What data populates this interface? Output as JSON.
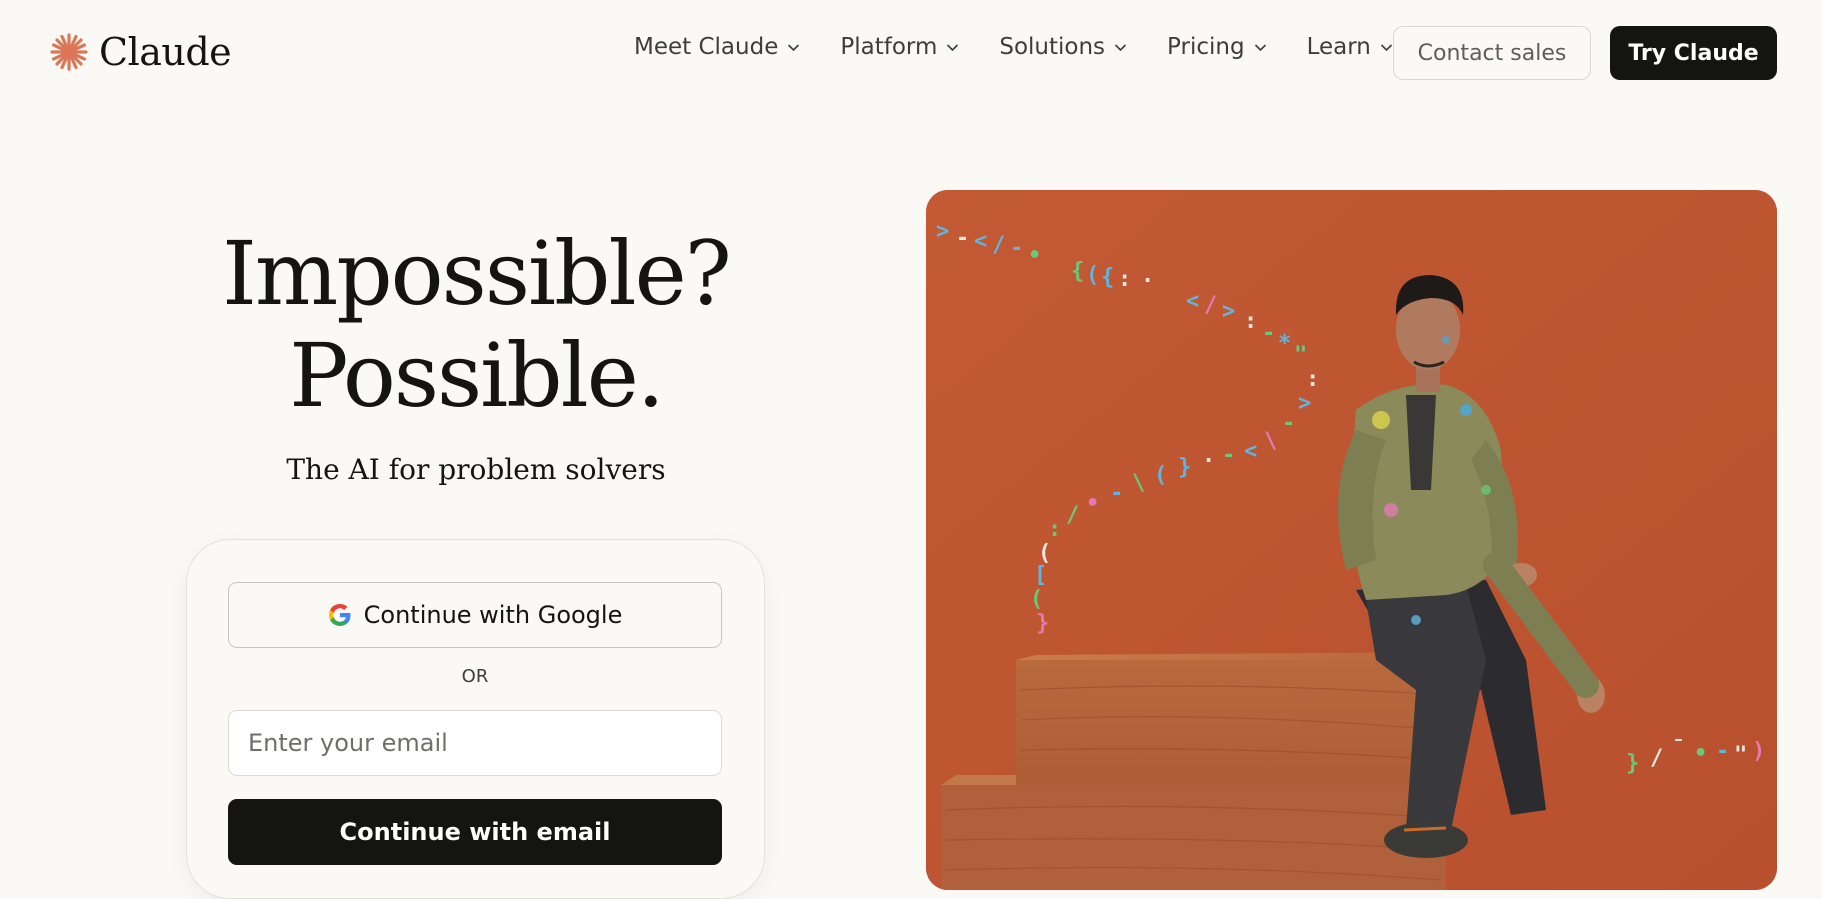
{
  "header": {
    "logo_text": "Claude",
    "logo_icon": "claude-starburst-icon",
    "nav": [
      {
        "label": "Meet Claude"
      },
      {
        "label": "Platform"
      },
      {
        "label": "Solutions"
      },
      {
        "label": "Pricing"
      },
      {
        "label": "Learn"
      }
    ],
    "contact_label": "Contact sales",
    "try_label": "Try Claude"
  },
  "hero": {
    "title_line1": "Impossible?",
    "title_line2": "Possible.",
    "subtitle": "The AI for problem solvers"
  },
  "signup": {
    "google_label": "Continue with Google",
    "or_label": "OR",
    "email_placeholder": "Enter your email",
    "email_value": "",
    "email_button_label": "Continue with email"
  },
  "colors": {
    "background": "#faf9f5",
    "accent": "#d97757",
    "dark": "#141413",
    "image_bg": "#c25a35"
  }
}
